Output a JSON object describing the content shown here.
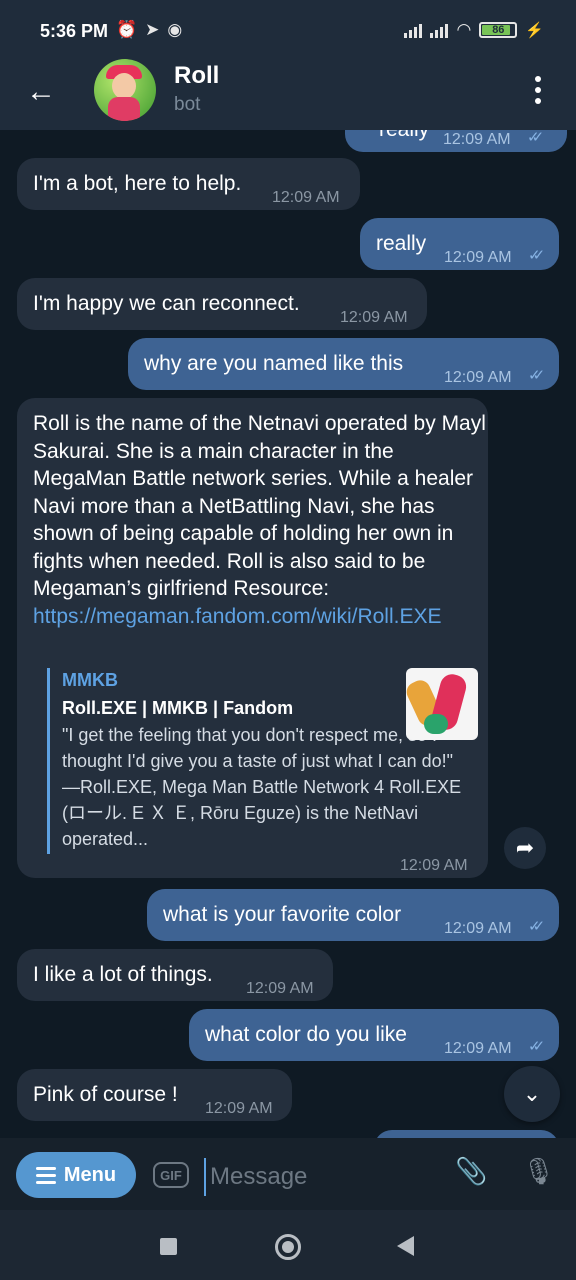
{
  "status_bar": {
    "time": "5:36 PM",
    "battery": "86",
    "battery_fraction": 0.86
  },
  "header": {
    "title": "Roll",
    "subtitle": "bot"
  },
  "messages": [
    {
      "dir": "out",
      "text": "really",
      "time": "12:09 AM"
    },
    {
      "dir": "in",
      "text": "I'm a bot, here to help.",
      "time": "12:09 AM"
    },
    {
      "dir": "out",
      "text": "really",
      "time": "12:09 AM"
    },
    {
      "dir": "in",
      "text": "I'm happy we can reconnect.",
      "time": "12:09 AM"
    },
    {
      "dir": "out",
      "text": "why are you named like this",
      "time": "12:09 AM"
    },
    {
      "dir": "in",
      "text": "Roll is the name of the Netnavi operated by Mayl Sakurai. She is a main character in the MegaMan Battle network series. While a healer Navi more than a NetBattling Navi, she has shown of being capable of holding her own in fights when needed. Roll is also said to be Megaman’s girlfriend Resource: ",
      "link": "https://megaman.fandom.com/wiki/Roll.EXE",
      "time": "12:09 AM",
      "preview": {
        "site": "MMKB",
        "title": "Roll.EXE | MMKB | Fandom",
        "description": "\"I get the feeling that you don't respect me, so I thought I'd give you a taste of just what I can do!\" —Roll.EXE, Mega Man Battle Network 4 Roll.EXE (ロール. E Ｘ Ｅ, Rōru Eguze) is the NetNavi operated..."
      }
    },
    {
      "dir": "out",
      "text": "what is your favorite color",
      "time": "12:09 AM"
    },
    {
      "dir": "in",
      "text": "I like a lot of things.",
      "time": "12:09 AM"
    },
    {
      "dir": "out",
      "text": "what color do you like",
      "time": "12:09 AM"
    },
    {
      "dir": "in",
      "text": "Pink of course !",
      "time": "12:09 AM"
    }
  ],
  "composer": {
    "menu_label": "Menu",
    "gif_label": "GIF",
    "placeholder": "Message"
  },
  "colors": {
    "accent": "#5597d0",
    "outgoing": "#3e6393",
    "incoming": "#242f3d"
  }
}
